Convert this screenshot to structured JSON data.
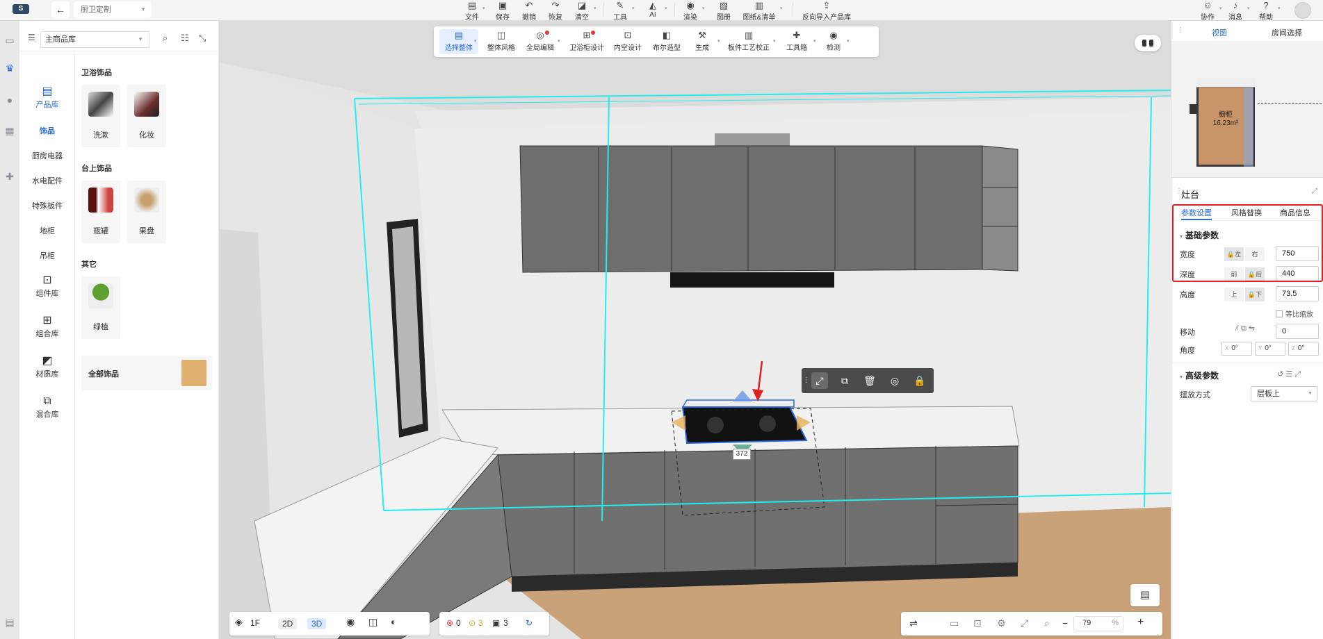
{
  "topbar": {
    "logo": "S",
    "back_icon": "arrow-left-icon",
    "project_name": "厨卫定制",
    "menu": [
      {
        "label": "文件",
        "icon": "file-icon",
        "has_dropdown": true
      },
      {
        "label": "保存",
        "icon": "save-icon"
      },
      {
        "label": "撤销",
        "icon": "undo-icon"
      },
      {
        "label": "恢复",
        "icon": "redo-icon"
      },
      {
        "label": "清空",
        "icon": "eraser-icon",
        "has_dropdown": true
      },
      {
        "label": "工具",
        "icon": "wrench-icon",
        "has_dropdown": true
      },
      {
        "label": "AI",
        "icon": "ai-icon",
        "has_dropdown": true
      },
      {
        "label": "渲染",
        "icon": "camera-icon",
        "has_dropdown": true
      },
      {
        "label": "图册",
        "icon": "album-icon"
      },
      {
        "label": "图纸&清单",
        "icon": "drawing-icon",
        "has_dropdown": true
      },
      {
        "label": "反向导入产品库",
        "icon": "import-icon"
      }
    ],
    "right_menu": [
      {
        "label": "协作",
        "icon": "collab-icon",
        "has_dropdown": true
      },
      {
        "label": "消息",
        "icon": "bell-icon",
        "has_dropdown": true
      },
      {
        "label": "帮助",
        "icon": "help-icon",
        "has_dropdown": true
      }
    ]
  },
  "product_panel": {
    "library_select": "主商品库",
    "categories_main": [
      {
        "label": "产品库",
        "icon": "product-library-icon",
        "active": true
      },
      {
        "label": "组件库",
        "icon": "component-library-icon"
      },
      {
        "label": "组合库",
        "icon": "combination-library-icon"
      },
      {
        "label": "材质库",
        "icon": "material-library-icon"
      },
      {
        "label": "混合库",
        "icon": "mixed-library-icon"
      }
    ],
    "sub_categories": [
      {
        "label": "饰品",
        "active": true
      },
      {
        "label": "厨房电器"
      },
      {
        "label": "水电配件"
      },
      {
        "label": "特殊板件"
      },
      {
        "label": "地柜"
      },
      {
        "label": "吊柜"
      }
    ],
    "groups": [
      {
        "title": "卫浴饰品",
        "items": [
          {
            "label": "洗漱"
          },
          {
            "label": "化妆"
          }
        ]
      },
      {
        "title": "台上饰品",
        "items": [
          {
            "label": "瓶罐"
          },
          {
            "label": "果盘"
          }
        ]
      },
      {
        "title": "其它",
        "items": [
          {
            "label": "绿植"
          }
        ]
      }
    ],
    "all_items_label": "全部饰品"
  },
  "viewport": {
    "toolbar": [
      {
        "label": "选择整体",
        "icon": "select-icon",
        "active": true,
        "has_dropdown": true
      },
      {
        "label": "整体风格",
        "icon": "style-icon"
      },
      {
        "label": "全局编辑",
        "icon": "global-edit-icon",
        "has_badge": true,
        "has_dropdown": true
      },
      {
        "label": "卫浴柜设计",
        "icon": "bath-cabinet-icon",
        "has_badge": true
      },
      {
        "label": "内空设计",
        "icon": "inner-space-icon"
      },
      {
        "label": "布尔造型",
        "icon": "boolean-icon"
      },
      {
        "label": "生成",
        "icon": "generate-icon",
        "has_dropdown": true
      },
      {
        "label": "板件工艺校正",
        "icon": "board-process-icon",
        "has_dropdown": true
      },
      {
        "label": "工具箱",
        "icon": "toolbox-icon",
        "has_dropdown": true
      },
      {
        "label": "检测",
        "icon": "detect-icon",
        "has_dropdown": true
      }
    ],
    "dimension_label": "372",
    "object_toolbar": [
      "resize-icon",
      "copy-icon",
      "delete-icon",
      "hide-icon",
      "lock-icon"
    ],
    "bottom_left": {
      "floor": "1F",
      "view_2d": "2D",
      "view_3d": "3D"
    },
    "status": {
      "errors": "0",
      "warnings": "3",
      "items": "3"
    },
    "zoom": {
      "value": "79",
      "unit": "%"
    }
  },
  "right_panel": {
    "tabs": [
      {
        "label": "视图",
        "active": true
      },
      {
        "label": "房间选择"
      }
    ],
    "minimap": {
      "room_name": "橱柜",
      "room_area": "16.23m²"
    },
    "object_title": "灶台",
    "property_tabs": [
      {
        "label": "参数设置",
        "active": true
      },
      {
        "label": "风格替换"
      },
      {
        "label": "商品信息"
      }
    ],
    "basic_section": "基础参数",
    "params": [
      {
        "label": "宽度",
        "opt_a": "左",
        "opt_b": "右",
        "value": "750"
      },
      {
        "label": "深度",
        "opt_a": "前",
        "opt_b": "后",
        "value": "440"
      },
      {
        "label": "高度",
        "opt_a": "上",
        "opt_b": "下",
        "value": "73.5"
      }
    ],
    "proportional_label": "等比缩放",
    "move_label": "移动",
    "move_value": "0",
    "angle_label": "角度",
    "angles": [
      {
        "axis": "X",
        "value": "0°"
      },
      {
        "axis": "Y",
        "value": "0°"
      },
      {
        "axis": "Z",
        "value": "0°"
      }
    ],
    "advanced_section": "高级参数",
    "placement_label": "摆放方式",
    "placement_value": "层板上"
  }
}
